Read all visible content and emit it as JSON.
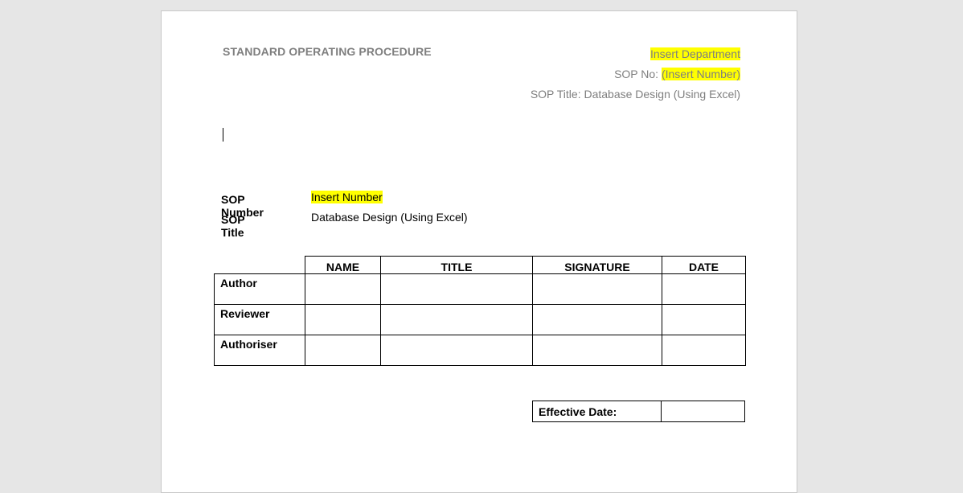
{
  "header": {
    "left_title": "STANDARD OPERATING PROCEDURE",
    "department": "Insert Department",
    "sop_no_label": "SOP No: ",
    "sop_no_value": "(Insert Number)",
    "sop_title_line": "SOP Title: Database Design (Using Excel)"
  },
  "sop_meta": {
    "number_label": "SOP Number",
    "number_value": "Insert Number",
    "title_label": "SOP Title",
    "title_value": "Database Design (Using Excel)"
  },
  "signature_table": {
    "columns": [
      "NAME",
      "TITLE",
      "SIGNATURE",
      "DATE"
    ],
    "rows": [
      "Author",
      "Reviewer",
      "Authoriser"
    ]
  },
  "effective": {
    "label": "Effective Date:",
    "value": ""
  },
  "colors": {
    "highlight": "#ffff00",
    "header_text": "#7f7f7f",
    "background": "#e6e6e6"
  }
}
